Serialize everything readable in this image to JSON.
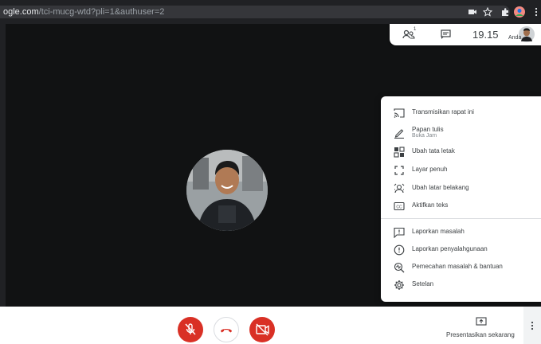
{
  "browser": {
    "url_prefix": "ogle.com",
    "url_path": "/tci-mucg-wtd?pli=1&authuser=2"
  },
  "meeting_info": {
    "participant_count": "1",
    "time": "19.15",
    "self_label": "Anda"
  },
  "menu": {
    "items": [
      {
        "label": "Transmisikan rapat ini",
        "icon": "cast-icon"
      },
      {
        "label": "Papan tulis",
        "sublabel": "Buka Jam",
        "icon": "whiteboard-icon"
      },
      {
        "label": "Ubah tata letak",
        "icon": "layout-icon"
      },
      {
        "label": "Layar penuh",
        "icon": "fullscreen-icon"
      },
      {
        "label": "Ubah latar belakang",
        "icon": "background-icon"
      },
      {
        "label": "Aktifkan teks",
        "icon": "captions-icon"
      },
      {
        "label": "Laporkan masalah",
        "icon": "report-problem-icon"
      },
      {
        "label": "Laporkan penyalahgunaan",
        "icon": "report-abuse-icon"
      },
      {
        "label": "Pemecahan masalah & bantuan",
        "icon": "troubleshoot-icon"
      },
      {
        "label": "Setelan",
        "icon": "settings-icon"
      }
    ]
  },
  "controls": {
    "present_label": "Presentasikan sekarang"
  },
  "colors": {
    "danger": "#d93025",
    "stage": "#111213",
    "menu_text": "#3c4043"
  }
}
